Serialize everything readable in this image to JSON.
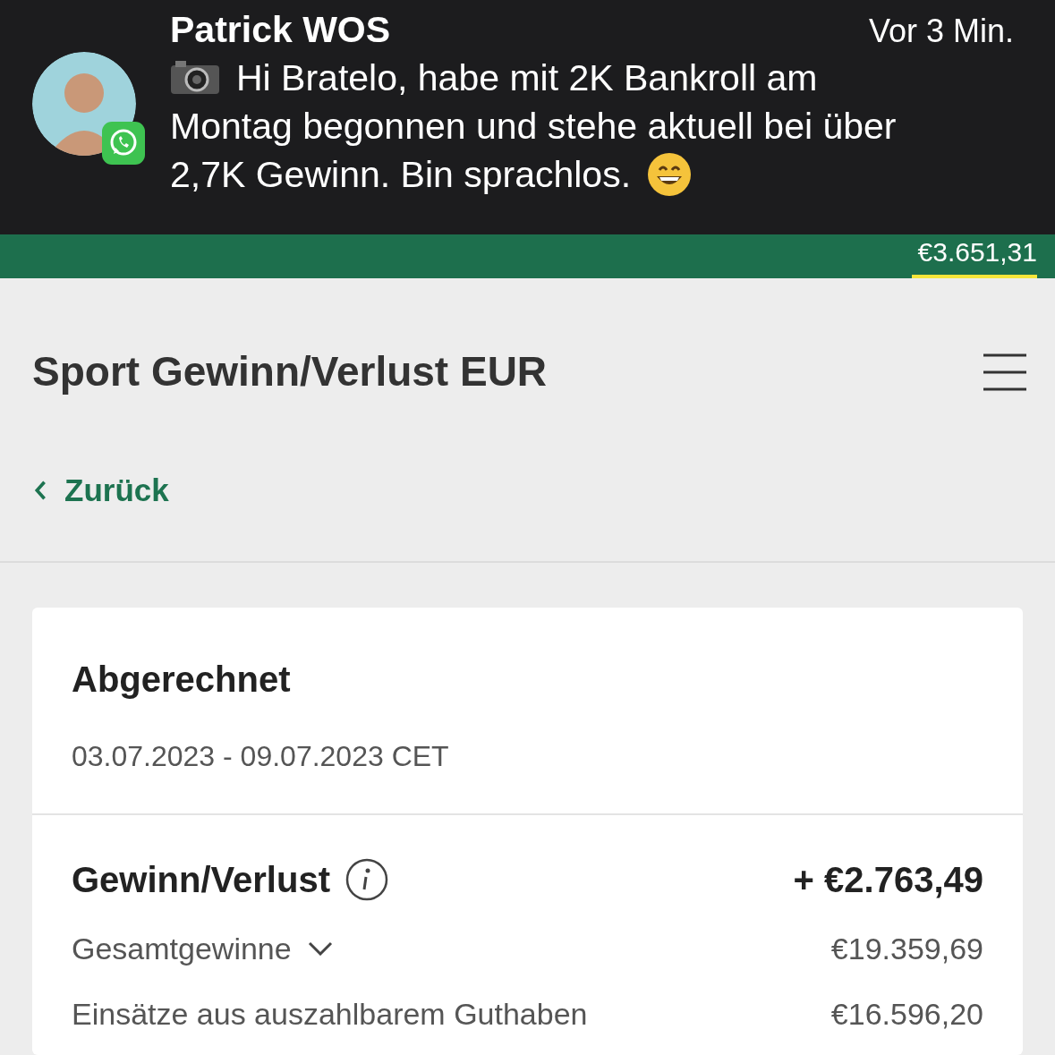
{
  "notification": {
    "sender": "Patrick WOS",
    "time": "Vor 3 Min.",
    "message_lines": [
      "Hi Bratelo, habe mit 2K Bankroll am",
      "Montag begonnen und stehe aktuell bei über",
      "2,7K Gewinn. Bin sprachlos."
    ]
  },
  "header": {
    "balance": "€3.651,31"
  },
  "page": {
    "title": "Sport Gewinn/Verlust EUR",
    "back": "Zurück"
  },
  "card": {
    "title": "Abgerechnet",
    "period": "03.07.2023 - 09.07.2023 CET",
    "total": {
      "label": "Gewinn/Verlust",
      "value": "+ €2.763,49"
    },
    "rows": [
      {
        "label": "Gesamtgewinne",
        "value": "€19.359,69",
        "expandable": true
      },
      {
        "label": "Einsätze aus auszahlbarem Guthaben",
        "value": "€16.596,20",
        "expandable": false
      }
    ]
  }
}
